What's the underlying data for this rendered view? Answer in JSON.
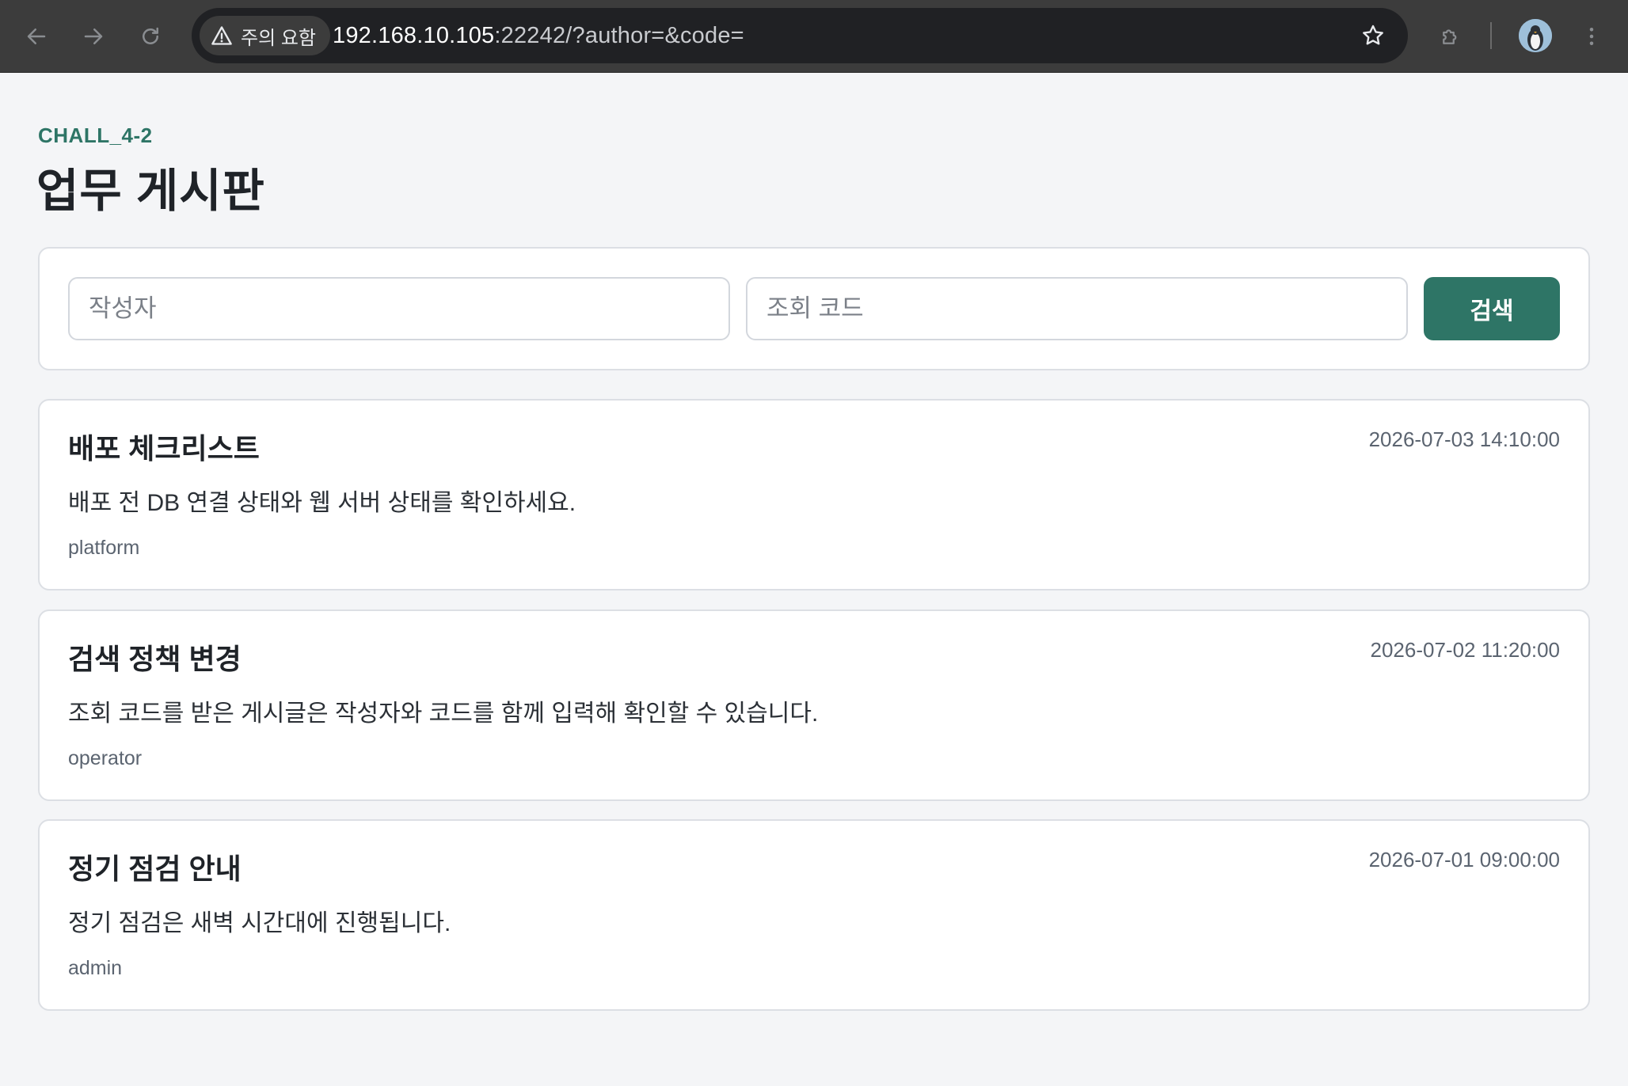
{
  "browser": {
    "security_label": "주의 요함",
    "url_host": "192.168.10.105",
    "url_rest": ":22242/?author=&code="
  },
  "header": {
    "eyebrow": "CHALL_4-2",
    "title": "업무 게시판"
  },
  "search": {
    "author_placeholder": "작성자",
    "author_value": "",
    "code_placeholder": "조회 코드",
    "code_value": "",
    "button_label": "검색",
    "accent_color": "#2e7566"
  },
  "posts": [
    {
      "title": "배포 체크리스트",
      "date": "2026-07-03 14:10:00",
      "body": "배포 전 DB 연결 상태와 웹 서버 상태를 확인하세요.",
      "author": "platform"
    },
    {
      "title": "검색 정책 변경",
      "date": "2026-07-02 11:20:00",
      "body": "조회 코드를 받은 게시글은 작성자와 코드를 함께 입력해 확인할 수 있습니다.",
      "author": "operator"
    },
    {
      "title": "정기 점검 안내",
      "date": "2026-07-01 09:00:00",
      "body": "정기 점검은 새벽 시간대에 진행됩니다.",
      "author": "admin"
    }
  ]
}
